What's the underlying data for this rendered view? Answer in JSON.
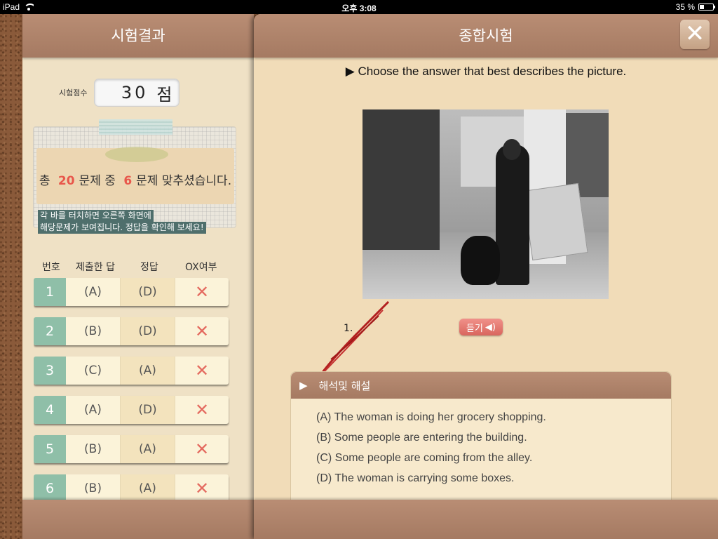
{
  "status_bar": {
    "device": "iPad",
    "time": "오후 3:08",
    "battery_percent_label": "35 %",
    "battery_level": 0.35
  },
  "left_panel": {
    "title": "시험결과",
    "score_label": "시험점수",
    "score_value": "30",
    "score_unit": "점",
    "summary": {
      "prefix": "총",
      "total": "20",
      "middle": "문제 중",
      "correct": "6",
      "suffix": "문제 맞추셨습니다."
    },
    "hint_line1": "각 바를 터치하면 오른쪽 화면에",
    "hint_line2": "해당문제가 보여집니다. 정답을 확인해 보세요!",
    "columns": [
      "번호",
      "제출한 답",
      "정답",
      "OX여부"
    ],
    "rows": [
      {
        "no": "1",
        "submitted": "(A)",
        "answer": "(D)",
        "ox": "✕"
      },
      {
        "no": "2",
        "submitted": "(B)",
        "answer": "(D)",
        "ox": "✕"
      },
      {
        "no": "3",
        "submitted": "(C)",
        "answer": "(A)",
        "ox": "✕"
      },
      {
        "no": "4",
        "submitted": "(A)",
        "answer": "(D)",
        "ox": "✕"
      },
      {
        "no": "5",
        "submitted": "(B)",
        "answer": "(A)",
        "ox": "✕"
      },
      {
        "no": "6",
        "submitted": "(B)",
        "answer": "(A)",
        "ox": "✕"
      }
    ]
  },
  "right_panel": {
    "title": "종합시험",
    "close_icon": "close-icon",
    "instruction": "▶ Choose the answer that best describes the picture.",
    "listen_label": "듣기",
    "question_number": "1.",
    "explanation_title": "해석및 해설",
    "options": [
      "(A) The woman is doing her grocery shopping.",
      "(B) Some people are entering the building.",
      "(C) Some people are coming from the alley.",
      "(D) The woman is carrying some boxes."
    ]
  },
  "colors": {
    "header_brown": "#a57a62",
    "number_green": "#8fbfa8",
    "wrong_red": "#e46a5f",
    "highlight_red": "#e8574b"
  }
}
